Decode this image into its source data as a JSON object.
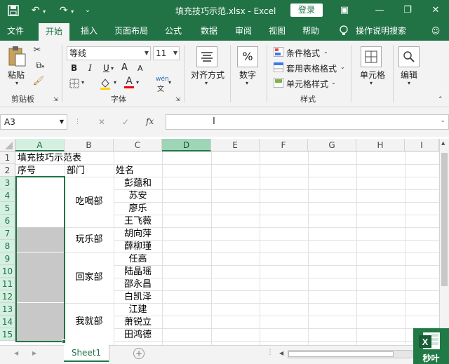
{
  "titlebar": {
    "save_icon": "save-icon",
    "undo_icon": "undo-icon",
    "redo_icon": "redo-icon",
    "filename": "填充技巧示范.xlsx  -  Excel",
    "login_label": "登录"
  },
  "tabs": [
    "文件",
    "开始",
    "插入",
    "页面布局",
    "公式",
    "数据",
    "审阅",
    "视图",
    "帮助",
    "操作说明搜索"
  ],
  "ribbon": {
    "paste_label": "粘贴",
    "clipboard_label": "剪贴板",
    "font_name": "等线",
    "font_size": "11",
    "bold": "B",
    "italic": "I",
    "underline": "U",
    "font_group_label": "字体",
    "align_label": "对齐方式",
    "number_label": "数字",
    "percent_symbol": "%",
    "cond_format_label": "条件格式",
    "table_format_label": "套用表格格式",
    "cell_style_label": "单元格样式",
    "styles_group_label": "样式",
    "cells_label": "单元格",
    "edit_label": "编辑",
    "wen_label": "wén",
    "a_upper": "A",
    "a_lower": "A"
  },
  "formula_bar": {
    "name_box": "A3",
    "cancel": "✕",
    "confirm": "✓",
    "fx": "fx",
    "content": ""
  },
  "grid": {
    "columns": [
      "A",
      "B",
      "C",
      "D",
      "E",
      "F",
      "G",
      "H",
      "I"
    ],
    "rows": [
      "1",
      "2",
      "3",
      "4",
      "5",
      "6",
      "7",
      "8",
      "9",
      "10",
      "11",
      "12",
      "13",
      "14",
      "15"
    ],
    "title": "填充技巧示范表",
    "headers": {
      "A": "序号",
      "B": "部门",
      "C": "姓名"
    },
    "departments": [
      "吃喝部",
      "玩乐部",
      "回家部",
      "我就部"
    ],
    "names": [
      "彭蕴和",
      "苏安",
      "廖乐",
      "王飞薇",
      "胡向萍",
      "薛柳瑾",
      "任高",
      "陆晶瑶",
      "邵永昌",
      "白凯泽",
      "江建",
      "萧锐立",
      "田鸿德"
    ]
  },
  "bottom": {
    "sheet_name": "Sheet1",
    "add_sheet": "+",
    "logo_text": "秒叶"
  },
  "colors": {
    "accent": "#217346",
    "selected_fill": "#c8c8c8"
  }
}
